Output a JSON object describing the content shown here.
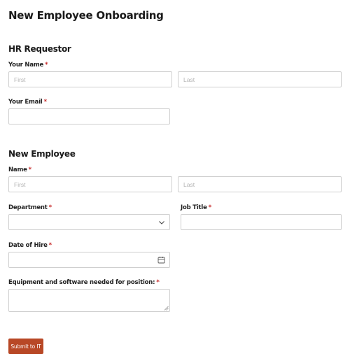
{
  "form": {
    "title": "New Employee Onboarding",
    "submit_label": "Submit to IT"
  },
  "hr_requestor": {
    "section_title": "HR Requestor",
    "name_label": "Your Name",
    "name_first_placeholder": "First",
    "name_last_placeholder": "Last",
    "email_label": "Your Email",
    "email_value": ""
  },
  "new_employee": {
    "section_title": "New Employee",
    "name_label": "Name",
    "name_first_placeholder": "First",
    "name_last_placeholder": "Last",
    "department_label": "Department",
    "department_value": "",
    "job_title_label": "Job Title",
    "job_title_value": "",
    "date_of_hire_label": "Date of Hire",
    "date_of_hire_value": "",
    "equipment_label": "Equipment and software needed for position:",
    "equipment_value": ""
  },
  "required_marker": "*",
  "icons": {
    "select": "chevron-down-icon",
    "date": "calendar-icon",
    "textarea_resize": "resize-grip-icon"
  },
  "colors": {
    "accent": "#b84826",
    "required": "#c62828",
    "border": "#cfcfcf",
    "placeholder": "#b3b3b3"
  }
}
